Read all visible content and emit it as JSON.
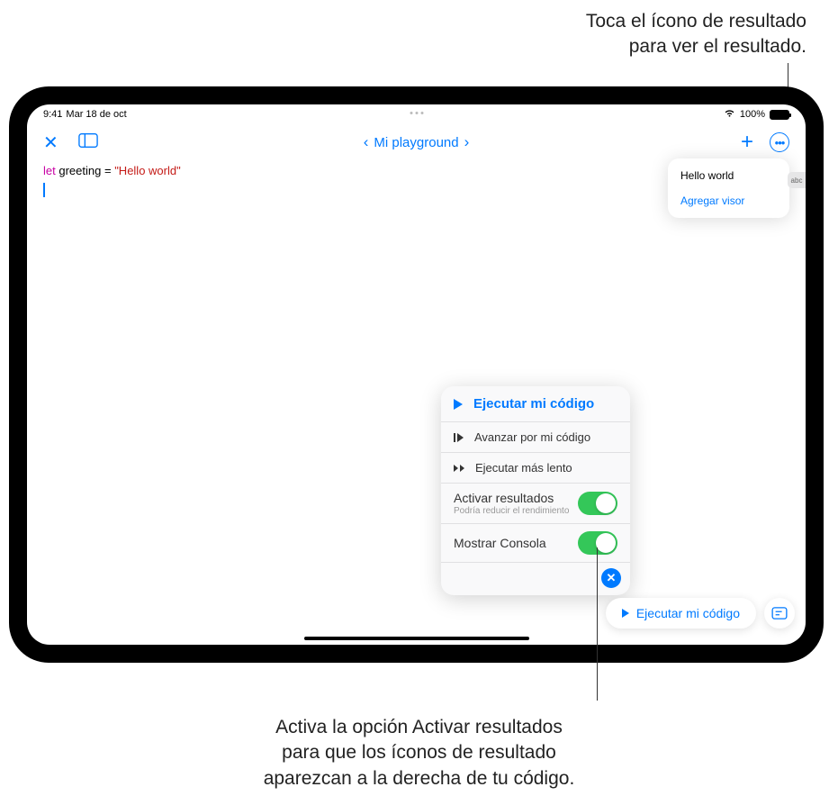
{
  "callouts": {
    "top": "Toca el ícono de resultado\npara ver el resultado.",
    "bottom": "Activa la opción Activar resultados\npara que los íconos de resultado\naparezcan a la derecha de tu código."
  },
  "statusbar": {
    "time": "9:41",
    "date": "Mar 18 de oct",
    "battery_pct": "100%"
  },
  "toolbar": {
    "title": "Mi playground"
  },
  "code": {
    "keyword": "let",
    "varname": "greeting",
    "equals": "=",
    "string": "\"Hello world\""
  },
  "result": {
    "value": "Hello world",
    "add_viewer": "Agregar visor",
    "tag": "abc"
  },
  "menu": {
    "run": "Ejecutar mi código",
    "step": "Avanzar por mi código",
    "slow": "Ejecutar más lento",
    "results_label": "Activar resultados",
    "results_sub": "Podría reducir el rendimiento",
    "console_label": "Mostrar Consola"
  },
  "runbar": {
    "label": "Ejecutar mi código"
  }
}
